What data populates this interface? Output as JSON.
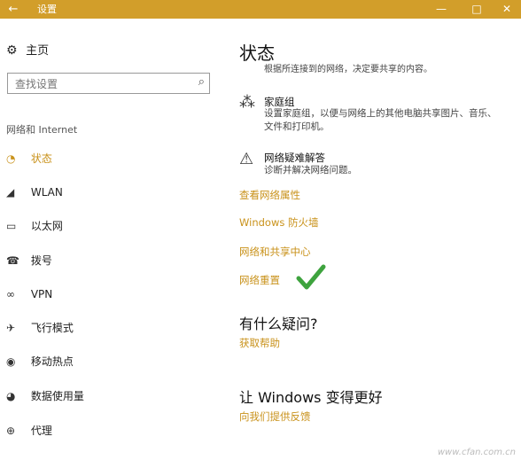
{
  "titlebar": {
    "back_icon": "arrow-left-icon",
    "title": "设置",
    "minimize": "—",
    "maximize": "□",
    "close": "✕",
    "color": "#d29e2a"
  },
  "sidebar": {
    "home_label": "主页",
    "search_placeholder": "查找设置",
    "section_title": "网络和 Internet",
    "items": [
      {
        "label": "状态",
        "icon": "globe-status-icon",
        "active": true
      },
      {
        "label": "WLAN",
        "icon": "wifi-icon"
      },
      {
        "label": "以太网",
        "icon": "ethernet-icon"
      },
      {
        "label": "拨号",
        "icon": "dialup-icon"
      },
      {
        "label": "VPN",
        "icon": "vpn-icon"
      },
      {
        "label": "飞行模式",
        "icon": "airplane-icon"
      },
      {
        "label": "移动热点",
        "icon": "hotspot-icon"
      },
      {
        "label": "数据使用量",
        "icon": "data-usage-icon"
      },
      {
        "label": "代理",
        "icon": "globe-icon"
      }
    ]
  },
  "main": {
    "title": "状态",
    "cutoff_text": "根据所连接到的网络，决定要共享的内容。",
    "homegroup": {
      "title": "家庭组",
      "desc": "设置家庭组，以便与网络上的其他电脑共享图片、音乐、文件和打印机。"
    },
    "troubleshoot": {
      "title": "网络疑难解答",
      "desc": "诊断并解决网络问题。"
    },
    "links": [
      "查看网络属性",
      "Windows 防火墙",
      "网络和共享中心",
      "网络重置"
    ],
    "help_heading": "有什么疑问?",
    "help_link": "获取帮助",
    "improve_heading": "让 Windows 变得更好",
    "feedback_link": "向我们提供反馈"
  },
  "accent_color": "#c9921b",
  "watermark": "www.cfan.com.cn"
}
